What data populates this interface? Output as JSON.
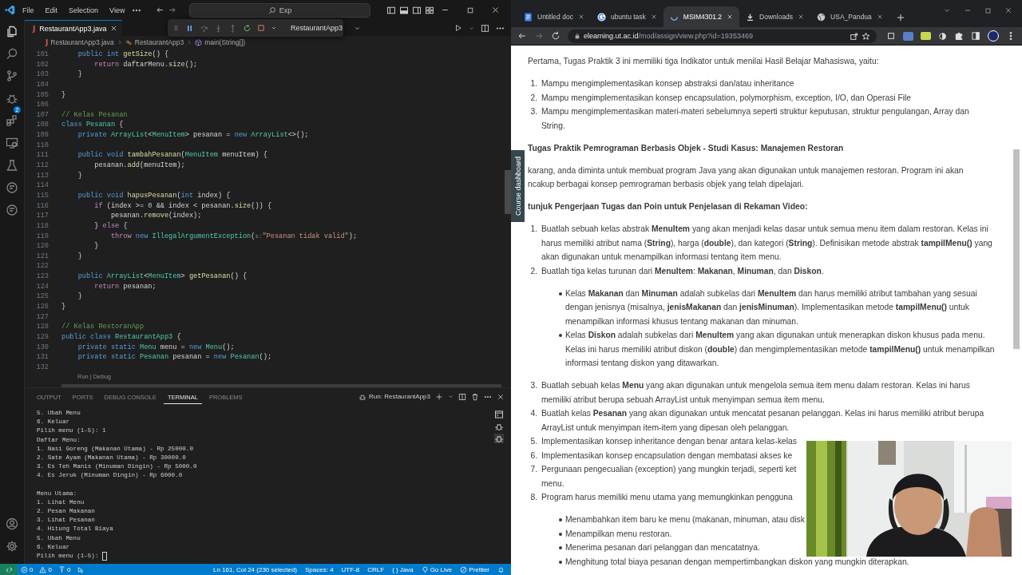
{
  "editor": {
    "menu": [
      "File",
      "Edit",
      "Selection",
      "View"
    ],
    "command_center": "Exp",
    "debug_toolbar": {
      "config": "RestaurantApp3"
    },
    "tabs": [
      {
        "label": "RestaurantApp3.java",
        "file_icon": "J",
        "selected": true
      }
    ],
    "breadcrumb": [
      {
        "kind": "file",
        "file_icon": "J",
        "text": "RestaurantApp3.java"
      },
      {
        "kind": "class",
        "text": "RestaurantApp3"
      },
      {
        "kind": "method",
        "text": "main(String[])"
      }
    ],
    "activity_badge": "2",
    "code_lines": [
      {
        "n": "101",
        "segments": [
          {
            "kind": "keyword",
            "text": "    public int "
          },
          {
            "kind": "function",
            "text": "getSize"
          },
          {
            "kind": "plain",
            "text": "() {"
          }
        ]
      },
      {
        "n": "102",
        "segments": [
          {
            "kind": "control",
            "text": "        return "
          },
          {
            "kind": "plain",
            "text": "daftarMenu."
          },
          {
            "kind": "function",
            "text": "size"
          },
          {
            "kind": "plain",
            "text": "();"
          }
        ]
      },
      {
        "n": "103",
        "segments": [
          {
            "kind": "plain",
            "text": "    }"
          }
        ]
      },
      {
        "n": "104"
      },
      {
        "n": "105",
        "segments": [
          {
            "kind": "plain",
            "text": "}"
          }
        ]
      },
      {
        "n": "106"
      },
      {
        "n": "107",
        "segments": [
          {
            "kind": "comment",
            "text": "// Kelas Pesanan"
          }
        ]
      },
      {
        "n": "108",
        "segments": [
          {
            "kind": "keyword",
            "text": "class "
          },
          {
            "kind": "type",
            "text": "Pesanan"
          },
          {
            "kind": "plain",
            "text": " {"
          }
        ]
      },
      {
        "n": "109",
        "segments": [
          {
            "kind": "keyword",
            "text": "    private "
          },
          {
            "kind": "type",
            "text": "ArrayList"
          },
          {
            "kind": "plain",
            "text": "<"
          },
          {
            "kind": "type",
            "text": "MenuItem"
          },
          {
            "kind": "plain",
            "text": "> pesanan = "
          },
          {
            "kind": "keyword",
            "text": "new "
          },
          {
            "kind": "type",
            "text": "ArrayList"
          },
          {
            "kind": "plain",
            "text": "<>();"
          }
        ]
      },
      {
        "n": "110"
      },
      {
        "n": "111",
        "segments": [
          {
            "kind": "keyword",
            "text": "    public void "
          },
          {
            "kind": "function",
            "text": "tambahPesanan"
          },
          {
            "kind": "plain",
            "text": "("
          },
          {
            "kind": "type",
            "text": "MenuItem"
          },
          {
            "kind": "plain",
            "text": " menuItem) {"
          }
        ]
      },
      {
        "n": "112",
        "segments": [
          {
            "kind": "plain",
            "text": "        pesanan."
          },
          {
            "kind": "function",
            "text": "add"
          },
          {
            "kind": "plain",
            "text": "(menuItem);"
          }
        ]
      },
      {
        "n": "113",
        "segments": [
          {
            "kind": "plain",
            "text": "    }"
          }
        ]
      },
      {
        "n": "114"
      },
      {
        "n": "115",
        "segments": [
          {
            "kind": "keyword",
            "text": "    public void "
          },
          {
            "kind": "function",
            "text": "hapusPesanan"
          },
          {
            "kind": "plain",
            "text": "("
          },
          {
            "kind": "keyword",
            "text": "int"
          },
          {
            "kind": "plain",
            "text": " index) {"
          }
        ]
      },
      {
        "n": "116",
        "segments": [
          {
            "kind": "control",
            "text": "        if "
          },
          {
            "kind": "plain",
            "text": "(index >= "
          },
          {
            "kind": "number",
            "text": "0"
          },
          {
            "kind": "plain",
            "text": " && index < pesanan."
          },
          {
            "kind": "function",
            "text": "size"
          },
          {
            "kind": "plain",
            "text": "()) {"
          }
        ]
      },
      {
        "n": "117",
        "segments": [
          {
            "kind": "plain",
            "text": "            pesanan."
          },
          {
            "kind": "function",
            "text": "remove"
          },
          {
            "kind": "plain",
            "text": "(index);"
          }
        ]
      },
      {
        "n": "118",
        "segments": [
          {
            "kind": "plain",
            "text": "        } "
          },
          {
            "kind": "control",
            "text": "else "
          },
          {
            "kind": "plain",
            "text": "{"
          }
        ]
      },
      {
        "n": "119",
        "segments": [
          {
            "kind": "control",
            "text": "            throw "
          },
          {
            "kind": "keyword",
            "text": "new "
          },
          {
            "kind": "type",
            "text": "IllegalArgumentException"
          },
          {
            "kind": "plain",
            "text": "("
          },
          {
            "kind": "hint",
            "text": "s:"
          },
          {
            "kind": "string",
            "text": "\"Pesanan tidak valid\""
          },
          {
            "kind": "plain",
            "text": ");"
          }
        ]
      },
      {
        "n": "120",
        "segments": [
          {
            "kind": "plain",
            "text": "        }"
          }
        ]
      },
      {
        "n": "121",
        "segments": [
          {
            "kind": "plain",
            "text": "    }"
          }
        ]
      },
      {
        "n": "122"
      },
      {
        "n": "123",
        "segments": [
          {
            "kind": "keyword",
            "text": "    public "
          },
          {
            "kind": "type",
            "text": "ArrayList"
          },
          {
            "kind": "plain",
            "text": "<"
          },
          {
            "kind": "type",
            "text": "MenuItem"
          },
          {
            "kind": "plain",
            "text": "> "
          },
          {
            "kind": "function",
            "text": "getPesanan"
          },
          {
            "kind": "plain",
            "text": "() {"
          }
        ]
      },
      {
        "n": "124",
        "segments": [
          {
            "kind": "control",
            "text": "        return "
          },
          {
            "kind": "plain",
            "text": "pesanan;"
          }
        ]
      },
      {
        "n": "125",
        "segments": [
          {
            "kind": "plain",
            "text": "    }"
          }
        ]
      },
      {
        "n": "126",
        "segments": [
          {
            "kind": "plain",
            "text": "}"
          }
        ]
      },
      {
        "n": "127"
      },
      {
        "n": "128",
        "segments": [
          {
            "kind": "comment",
            "text": "// Kelas RestoranApp"
          }
        ]
      },
      {
        "n": "129",
        "segments": [
          {
            "kind": "keyword",
            "text": "public class "
          },
          {
            "kind": "type",
            "text": "RestaurantApp3"
          },
          {
            "kind": "plain",
            "text": " {"
          }
        ]
      },
      {
        "n": "130",
        "segments": [
          {
            "kind": "keyword",
            "text": "    private static "
          },
          {
            "kind": "type",
            "text": "Menu"
          },
          {
            "kind": "plain",
            "text": " menu = "
          },
          {
            "kind": "keyword",
            "text": "new "
          },
          {
            "kind": "type",
            "text": "Menu"
          },
          {
            "kind": "plain",
            "text": "();"
          }
        ]
      },
      {
        "n": "131",
        "segments": [
          {
            "kind": "keyword",
            "text": "    private static "
          },
          {
            "kind": "type",
            "text": "Pesanan"
          },
          {
            "kind": "plain",
            "text": " pesanan = "
          },
          {
            "kind": "keyword",
            "text": "new "
          },
          {
            "kind": "type",
            "text": "Pesanan"
          },
          {
            "kind": "plain",
            "text": "();"
          }
        ]
      },
      {
        "n": "132"
      }
    ],
    "codelens": "Run | Debug",
    "panel": {
      "tabs": [
        {
          "label": "OUTPUT",
          "selected": false
        },
        {
          "label": "PORTS",
          "selected": false
        },
        {
          "label": "DEBUG CONSOLE",
          "selected": false
        },
        {
          "label": "TERMINAL",
          "selected": true
        },
        {
          "label": "PROBLEMS",
          "selected": false
        }
      ],
      "run_label": "Run: RestaurantApp3",
      "terminal_blocks": [
        [
          "5. Ubah Menu",
          "6. Keluar",
          "Pilih menu (1-5): 1",
          "Daftar Menu:",
          "1. Nasi Goreng (Makanan Utama) - Rp 25000.0",
          "2. Sate Ayam (Makanan Utama) - Rp 30000.0",
          "3. Es Teh Manis (Minuman Dingin) - Rp 5000.0",
          "4. Es Jeruk (Minuman Dingin) - Rp 6000.0"
        ],
        [
          "Menu Utama:",
          "1. Lihat Menu",
          "2. Pesan Makanan",
          "3. Lihat Pesanan",
          "4. Hitung Total Biaya",
          "5. Ubah Menu",
          "6. Keluar",
          "Pilih menu (1-5):"
        ]
      ]
    },
    "status_bar": {
      "left": [
        {
          "kind": "errors",
          "text": "0"
        },
        {
          "kind": "warnings",
          "text": "0"
        },
        {
          "kind": "ports",
          "text": "0"
        },
        {
          "kind": "debug"
        }
      ],
      "right": [
        {
          "kind": "text",
          "text": "Ln 161, Col 24 (230 selected)"
        },
        {
          "kind": "text",
          "text": "Spaces: 4"
        },
        {
          "kind": "text",
          "text": "UTF-8"
        },
        {
          "kind": "text",
          "text": "CRLF"
        },
        {
          "kind": "language",
          "icon": "{ }",
          "text": "Java"
        },
        {
          "kind": "golive",
          "text": "Go Live"
        },
        {
          "kind": "prettier",
          "text": "Prettier"
        },
        {
          "kind": "bell"
        }
      ]
    }
  },
  "browser": {
    "tabs": [
      {
        "label": "Untitled doc",
        "kind": "docs",
        "selected": false
      },
      {
        "label": "ubuntu task",
        "kind": "google",
        "selected": false
      },
      {
        "label": "MSIM4301.2",
        "kind": "moodle",
        "selected": true
      },
      {
        "label": "Downloads",
        "kind": "download",
        "selected": false
      },
      {
        "label": "USA_Pandua",
        "kind": "globe",
        "selected": false
      }
    ],
    "url": {
      "host": "elearning.ut.ac.id",
      "path": "/mod/assign/view.php?id=19353469"
    },
    "drawer_tab": "Course dashboard",
    "content": [
      {
        "kind": "para",
        "lines": [
          "Pertama, Tugas Praktik 3 ini memiliki tiga Indikator untuk menilai Hasil Belajar Mahasiswa, yaitu:"
        ]
      },
      {
        "kind": "ol",
        "number": "1.",
        "lines": [
          "Mampu mengimplementasikan konsep abstraksi dan/atau inheritance"
        ]
      },
      {
        "kind": "ol",
        "number": "2.",
        "lines": [
          "Mampu mengimplementasikan konsep encapsulation, polymorphism, exception, I/O, dan Operasi File"
        ]
      },
      {
        "kind": "ol",
        "number": "3.",
        "lines": [
          "Mampu mengimplementasikan materi-materi sebelumnya seperti struktur keputusan, struktur pengulangan, Array dan",
          "String."
        ]
      },
      {
        "kind": "heading",
        "lines": [
          "Tugas Praktik Pemrograman Berbasis Objek - Studi Kasus: Manajemen Restoran"
        ]
      },
      {
        "kind": "para",
        "lines": [
          "karang, anda diminta untuk membuat program Java yang akan digunakan untuk manajemen restoran. Program ini akan",
          "ncakup berbagai konsep pemrograman berbasis objek yang telah dipelajari."
        ]
      },
      {
        "kind": "heading",
        "lines": [
          "tunjuk Pengerjaan Tugas dan Poin untuk Penjelasan di Rekaman Video:"
        ]
      },
      {
        "kind": "ol",
        "number": "1.",
        "lines": [
          "Buatlah sebuah kelas abstrak **MenuItem** yang akan menjadi kelas dasar untuk semua menu item dalam restoran. Kelas ini",
          "harus memiliki atribut nama (**String**), harga (**double**), dan kategori (**String**). Definisikan metode abstrak **tampilMenu()** yang",
          "akan digunakan untuk menampilkan informasi tentang item menu."
        ]
      },
      {
        "kind": "ol",
        "number": "2.",
        "lines": [
          "Buatlah tiga kelas turunan dari **MenuItem**: **Makanan**, **Minuman**, dan **Diskon**."
        ]
      },
      {
        "kind": "li",
        "lines": [
          "Kelas **Makanan** dan **Minuman** adalah subkelas dari **MenuItem** dan harus memiliki atribut tambahan yang sesuai",
          "dengan jenisnya (misalnya, **jenisMakanan** dan **jenisMinuman**). Implementasikan metode **tampilMenu()** untuk",
          "menampilkan informasi khusus tentang makanan dan minuman."
        ]
      },
      {
        "kind": "li",
        "lines": [
          "Kelas **Diskon** adalah subkelas dari **MenuItem** yang akan digunakan untuk menerapkan diskon khusus pada menu.",
          "Kelas ini harus memiliki atribut diskon (**double**) dan mengimplementasikan metode **tampilMenu()** untuk menampilkan",
          "informasi tentang diskon yang ditawarkan."
        ]
      },
      {
        "kind": "ol",
        "number": "3.",
        "lines": [
          "Buatlah sebuah kelas **Menu** yang akan digunakan untuk mengelola semua item menu dalam restoran. Kelas ini harus",
          "memiliki atribut berupa sebuah ArrayList untuk menyimpan semua item menu."
        ]
      },
      {
        "kind": "ol",
        "number": "4.",
        "lines": [
          "Buatlah kelas **Pesanan** yang akan digunakan untuk mencatat pesanan pelanggan. Kelas ini harus memiliki atribut berupa",
          "ArrayList untuk menyimpan item-item yang dipesan oleh pelanggan."
        ]
      },
      {
        "kind": "ol",
        "number": "5.",
        "lines": [
          "Implementasikan konsep inheritance dengan benar antara kelas-kelas"
        ]
      },
      {
        "kind": "ol",
        "number": "6.",
        "lines": [
          "Implementasikan konsep encapsulation dengan membatasi akses ke"
        ]
      },
      {
        "kind": "ol",
        "number": "7.",
        "lines": [
          "Pergunaan pengecualian (exception) yang mungkin terjadi, seperti ket",
          "menu."
        ]
      },
      {
        "kind": "ol",
        "number": "8.",
        "lines": [
          "Program harus memiliki menu utama yang memungkinkan pengguna"
        ]
      },
      {
        "kind": "li",
        "lines": [
          "Menambahkan item baru ke menu (makanan, minuman, atau disk"
        ]
      },
      {
        "kind": "li",
        "lines": [
          "Menampilkan menu restoran."
        ]
      },
      {
        "kind": "li",
        "lines": [
          "Menerima pesanan dari pelanggan dan mencatatnya."
        ]
      },
      {
        "kind": "li",
        "lines": [
          "Menghitung total biaya pesanan dengan mempertimbangkan diskon yang mungkin diterapkan."
        ]
      }
    ]
  }
}
